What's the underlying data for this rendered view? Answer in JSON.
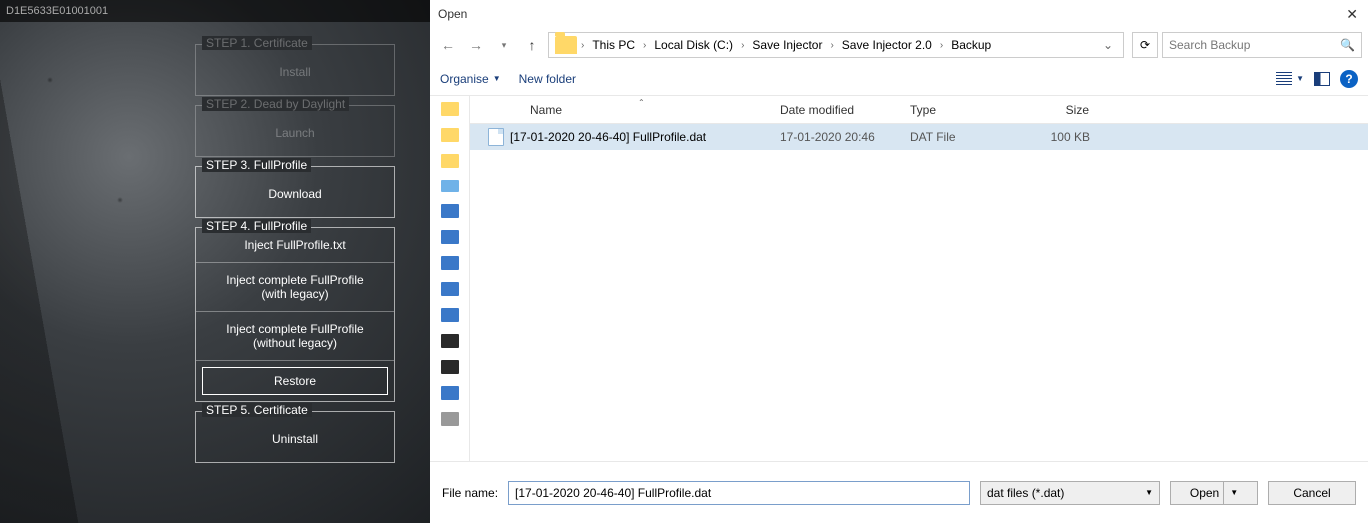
{
  "app": {
    "title": "D1E5633E01001001",
    "steps": [
      {
        "legend": "STEP 1. Certificate",
        "action": "Install",
        "dim": true
      },
      {
        "legend": "STEP 2. Dead by Daylight",
        "action": "Launch",
        "dim": true
      },
      {
        "legend": "STEP 3. FullProfile",
        "action": "Download",
        "dim": false
      },
      {
        "legend": "STEP 4. FullProfile",
        "actions": [
          "Inject FullProfile.txt",
          "Inject complete FullProfile\n(with legacy)",
          "Inject complete FullProfile\n(without legacy)",
          "Restore"
        ],
        "dim": false
      },
      {
        "legend": "STEP 5. Certificate",
        "action": "Uninstall",
        "dim": false
      }
    ]
  },
  "dialog": {
    "title": "Open",
    "breadcrumb": [
      "This PC",
      "Local Disk (C:)",
      "Save Injector",
      "Save Injector 2.0",
      "Backup"
    ],
    "search_placeholder": "Search Backup",
    "toolbar": {
      "organise": "Organise",
      "newfolder": "New folder"
    },
    "columns": {
      "name": "Name",
      "date": "Date modified",
      "type": "Type",
      "size": "Size"
    },
    "rows": [
      {
        "name": "[17-01-2020 20-46-40] FullProfile.dat",
        "date": "17-01-2020 20:46",
        "type": "DAT File",
        "size": "100 KB"
      }
    ],
    "filename_label": "File name:",
    "filename_value": "[17-01-2020 20-46-40] FullProfile.dat",
    "filetype": "dat files (*.dat)",
    "open_btn": "Open",
    "cancel_btn": "Cancel"
  }
}
